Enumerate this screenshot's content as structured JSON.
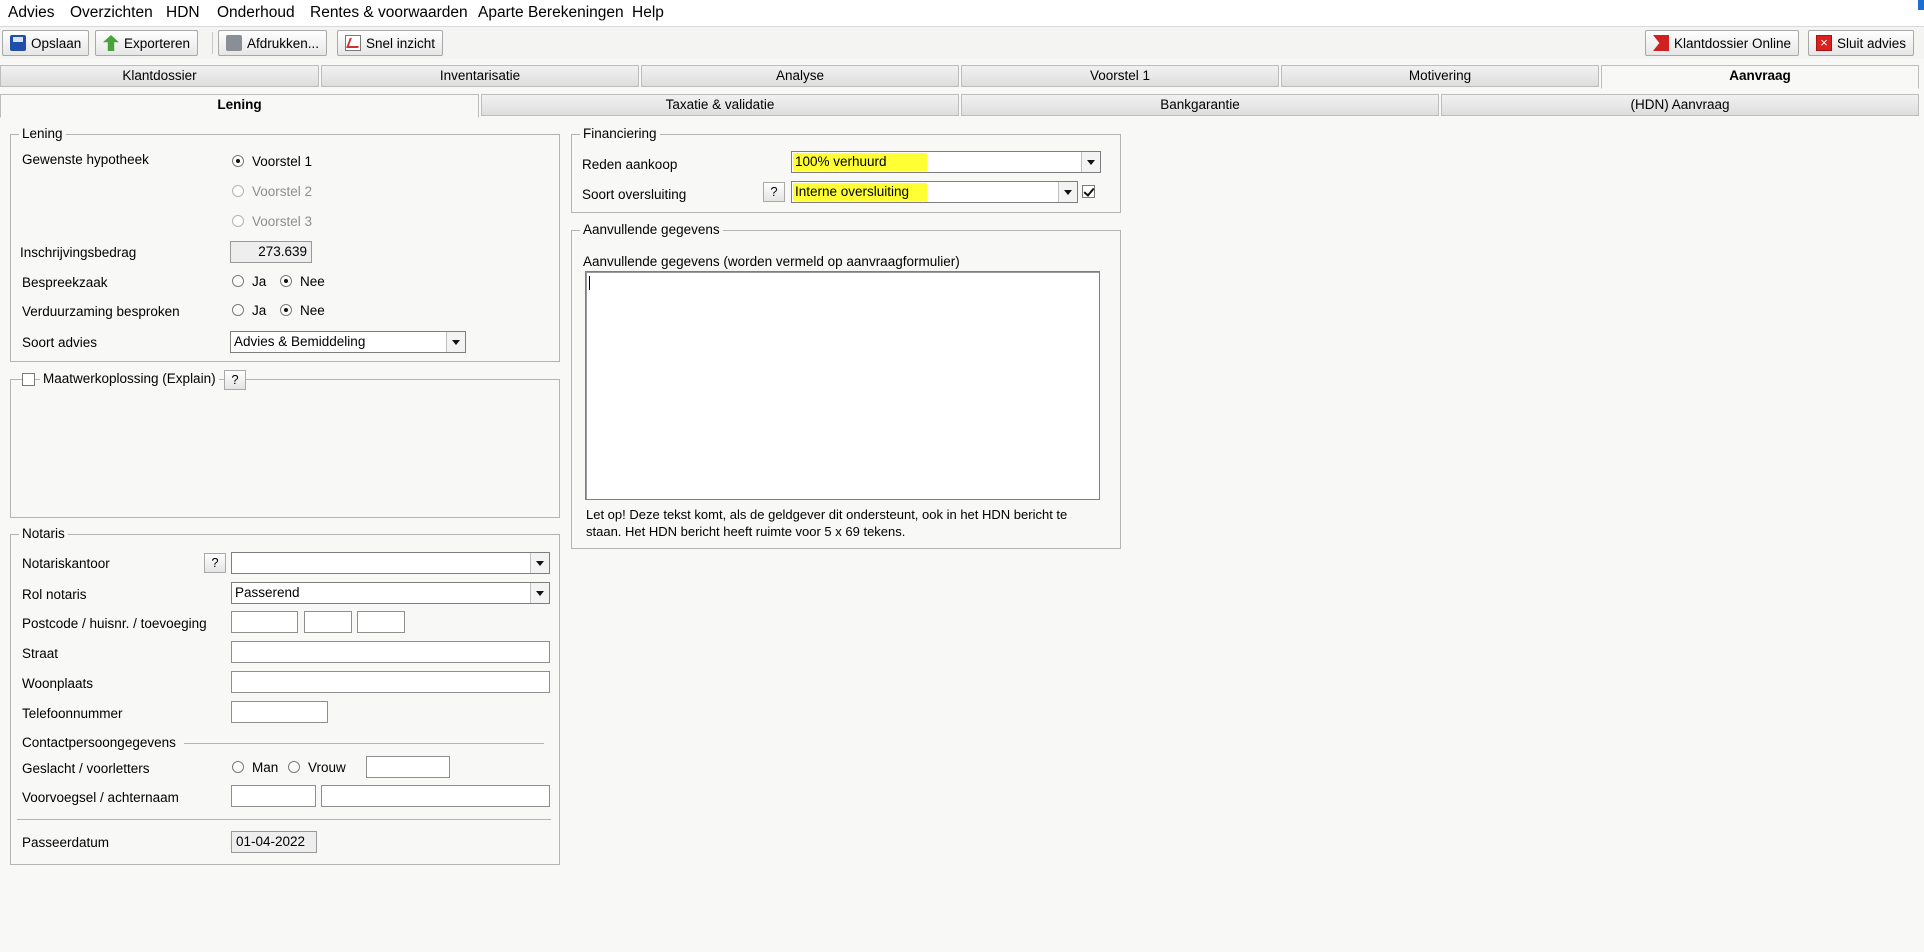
{
  "menu": [
    "Advies",
    "Overzichten",
    "HDN",
    "Onderhoud",
    "Rentes & voorwaarden",
    "Aparte Berekeningen",
    "Help"
  ],
  "toolbar": {
    "save": "Opslaan",
    "export": "Exporteren",
    "print": "Afdrukken...",
    "quick": "Snel inzicht",
    "klantdossier_online": "Klantdossier Online",
    "close_advice": "Sluit advies"
  },
  "main_tabs": [
    "Klantdossier",
    "Inventarisatie",
    "Analyse",
    "Voorstel 1",
    "Motivering",
    "Aanvraag"
  ],
  "sub_tabs": [
    "Lening",
    "Taxatie & validatie",
    "Bankgarantie",
    "(HDN) Aanvraag"
  ],
  "lening": {
    "legend": "Lening",
    "gewenste_label": "Gewenste hypotheek",
    "voorstel_options": [
      "Voorstel 1",
      "Voorstel 2",
      "Voorstel 3"
    ],
    "inschrijving_label": "Inschrijvingsbedrag",
    "inschrijving_value": "273.639",
    "bespreekzaak_label": "Bespreekzaak",
    "verduurzaming_label": "Verduurzaming besproken",
    "ja": "Ja",
    "nee": "Nee",
    "soort_advies_label": "Soort advies",
    "soort_advies_value": "Advies & Bemiddeling"
  },
  "maatwerk": {
    "label": "Maatwerkoplossing (Explain)",
    "help": "?"
  },
  "notaris": {
    "legend": "Notaris",
    "kantoor_label": "Notariskantoor",
    "kantoor_value": "",
    "help": "?",
    "rol_label": "Rol notaris",
    "rol_value": "Passerend",
    "postcode_label": "Postcode / huisnr. / toevoeging",
    "straat_label": "Straat",
    "woonplaats_label": "Woonplaats",
    "telefoon_label": "Telefoonnummer",
    "contact_label": "Contactpersoongegevens",
    "geslacht_label": "Geslacht / voorletters",
    "man": "Man",
    "vrouw": "Vrouw",
    "naam_label": "Voorvoegsel / achternaam",
    "passeer_label": "Passeerdatum",
    "passeer_value": "01-04-2022"
  },
  "financiering": {
    "legend": "Financiering",
    "reden_label": "Reden aankoop",
    "reden_value": "100% verhuurd",
    "oversluiting_label": "Soort oversluiting",
    "oversluiting_value": "Interne oversluiting",
    "help": "?",
    "highlight_color": "#ffff33"
  },
  "aanvullend": {
    "legend": "Aanvullende gegevens",
    "label": "Aanvullende gegevens (worden vermeld op aanvraagformulier)",
    "note_line1": "Let op! Deze tekst komt, als de geldgever dit ondersteunt, ook in het HDN bericht te",
    "note_line2": "staan. Het HDN bericht heeft ruimte voor 5 x 69 tekens."
  }
}
